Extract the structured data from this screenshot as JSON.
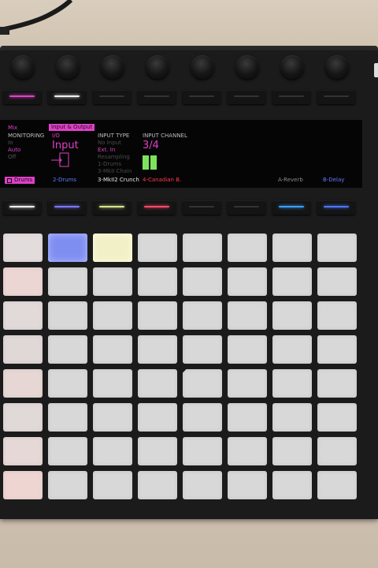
{
  "screen": {
    "left_col": {
      "mix": "Mix",
      "monitoring": "MONITORING",
      "monitoring_in": "In",
      "monitoring_auto": "Auto",
      "monitoring_off": "Off"
    },
    "io_tab": "Input & Output",
    "io_label": "I/O",
    "io_value": "Input",
    "input_type": {
      "header": "INPUT TYPE",
      "options": [
        "No Input",
        "Ext. In",
        "Resampling",
        "1-Drums",
        "3-MkII Chain"
      ],
      "selected": "Ext. In"
    },
    "input_channel": {
      "header": "INPUT CHANNEL",
      "value": "3/4"
    },
    "tracks": [
      "Drums",
      "2-Drums",
      "3-MkII2 Crunch",
      "4-Canadian B.",
      "",
      "",
      "A-Reverb",
      "B-Delay"
    ]
  },
  "colors": {
    "magenta": "#e040c8",
    "blue": "#5d7cff",
    "yellow": "#e7e6a8",
    "green": "#7ee35c",
    "red": "#ff3a52"
  },
  "top_leds": [
    "magenta",
    "white",
    "off",
    "off",
    "off",
    "off",
    "off",
    "off"
  ],
  "bottom_leds": [
    "white",
    "blue",
    "yellow",
    "red",
    "off",
    "off",
    "cyan",
    "blue"
  ]
}
